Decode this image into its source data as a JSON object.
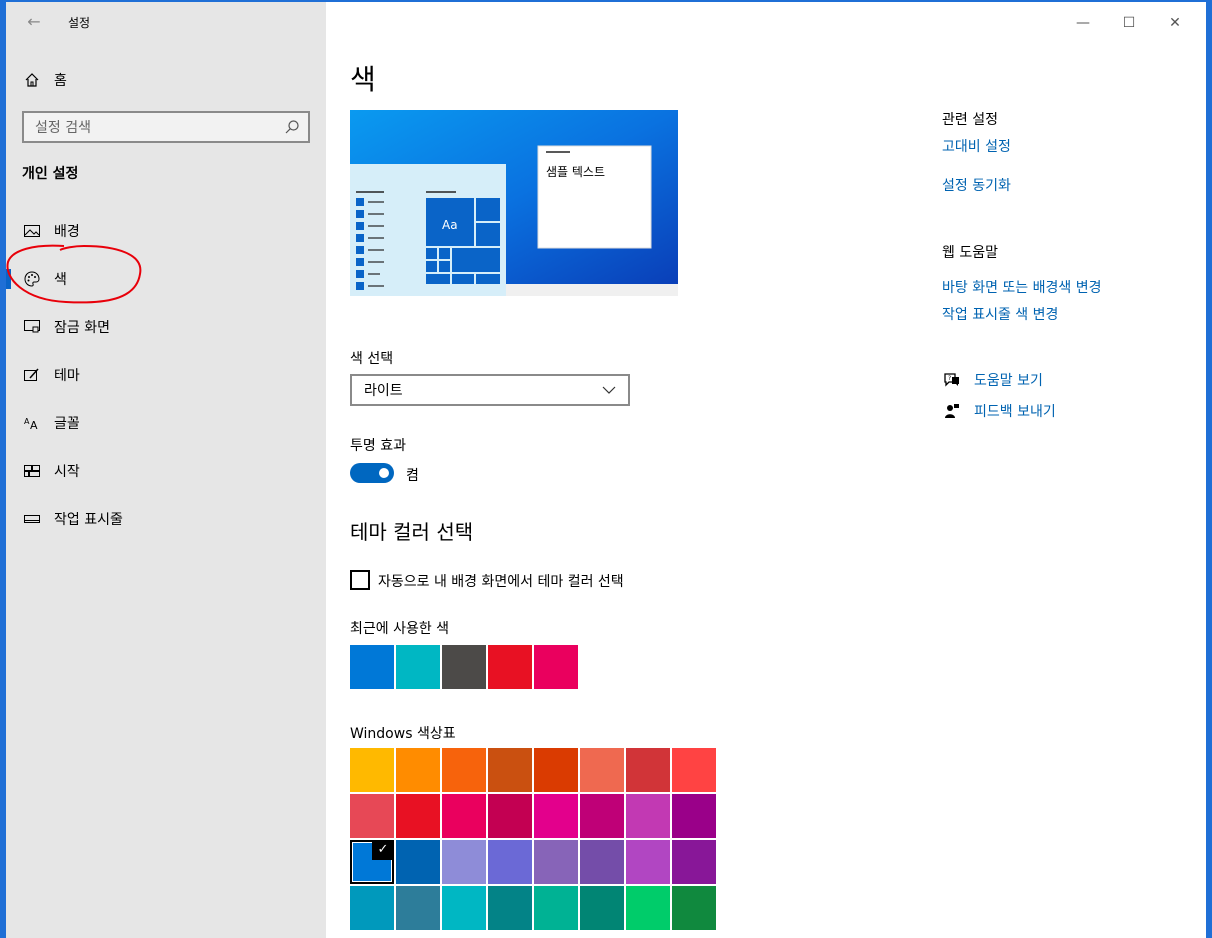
{
  "window": {
    "title": "설정",
    "back_glyph": "←",
    "minimize": "—",
    "maximize": "☐",
    "close": "✕"
  },
  "sidebar": {
    "home": "홈",
    "search_placeholder": "설정 검색",
    "section_title": "개인 설정",
    "items": [
      {
        "label": "배경",
        "icon": "picture-icon"
      },
      {
        "label": "색",
        "icon": "palette-icon",
        "selected": true
      },
      {
        "label": "잠금 화면",
        "icon": "lock-screen-icon"
      },
      {
        "label": "테마",
        "icon": "theme-icon"
      },
      {
        "label": "글꼴",
        "icon": "font-icon"
      },
      {
        "label": "시작",
        "icon": "start-icon"
      },
      {
        "label": "작업 표시줄",
        "icon": "taskbar-icon"
      }
    ]
  },
  "main": {
    "title": "색",
    "preview": {
      "sample_text": "샘플 텍스트",
      "tile_text": "Aa"
    },
    "choose_color_label": "색 선택",
    "choose_color_value": "라이트",
    "transparency_label": "투명 효과",
    "transparency_state": "켬",
    "accent_heading": "테마 컬러 선택",
    "auto_accent_label": "자동으로 내 배경 화면에서 테마 컬러 선택",
    "recent_label": "최근에 사용한 색",
    "recent_colors": [
      "#0078d7",
      "#00b7c3",
      "#4c4a48",
      "#e81123",
      "#ea005e"
    ],
    "palette_label": "Windows 색상표",
    "palette": [
      [
        "#ffb900",
        "#ff8c00",
        "#f7630c",
        "#ca5010",
        "#da3b01",
        "#ef6950",
        "#d13438",
        "#ff4343"
      ],
      [
        "#e74856",
        "#e81123",
        "#ea005e",
        "#c30052",
        "#e3008c",
        "#bf0077",
        "#c239b3",
        "#9a0089"
      ],
      [
        "#0078d7",
        "#0063b1",
        "#8e8cd8",
        "#6b69d6",
        "#8764b8",
        "#744da9",
        "#b146c2",
        "#881798"
      ],
      [
        "#0099bc",
        "#2d7d9a",
        "#00b7c3",
        "#038387",
        "#00b294",
        "#018574",
        "#00cc6a",
        "#10893e"
      ]
    ],
    "selected_palette": {
      "row": 2,
      "col": 0
    }
  },
  "related": {
    "heading": "관련 설정",
    "links": [
      "고대비 설정",
      "설정 동기화"
    ],
    "web_help_heading": "웹 도움말",
    "web_links": [
      "바탕 화면 또는 배경색 변경",
      "작업 표시줄 색 변경"
    ],
    "get_help": "도움말 보기",
    "feedback": "피드백 보내기"
  }
}
